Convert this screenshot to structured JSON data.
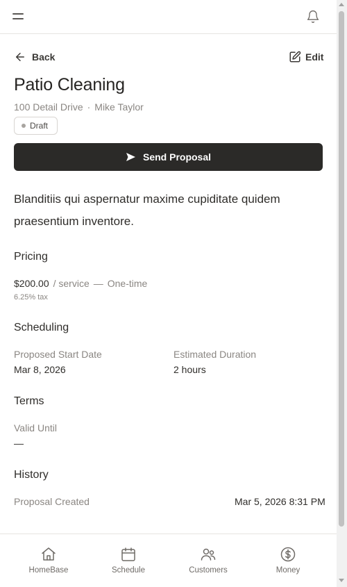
{
  "topbar": {
    "menu_icon": "hamburger-icon",
    "bell_icon": "bell-icon"
  },
  "nav": {
    "back_label": "Back",
    "edit_label": "Edit"
  },
  "job": {
    "title": "Patio Cleaning",
    "address": "100 Detail Drive",
    "separator": "·",
    "customer": "Mike Taylor",
    "status": "Draft",
    "description": "Blanditiis qui aspernatur maxime cupiditate quidem praesentium inventore."
  },
  "actions": {
    "send_label": "Send Proposal"
  },
  "pricing": {
    "heading": "Pricing",
    "amount": "$200.00",
    "unit": "/ service",
    "dash": "—",
    "frequency": "One-time",
    "tax": "6.25% tax"
  },
  "scheduling": {
    "heading": "Scheduling",
    "start_label": "Proposed Start Date",
    "start_value": "Mar 8, 2026",
    "duration_label": "Estimated Duration",
    "duration_value": "2 hours"
  },
  "terms": {
    "heading": "Terms",
    "valid_label": "Valid Until",
    "valid_value": "—"
  },
  "history": {
    "heading": "History",
    "event_label": "Proposal Created",
    "event_time": "Mar 5, 2026 8:31 PM"
  },
  "bottom_nav": [
    {
      "label": "HomeBase",
      "icon": "home-icon"
    },
    {
      "label": "Schedule",
      "icon": "calendar-icon"
    },
    {
      "label": "Customers",
      "icon": "users-icon"
    },
    {
      "label": "Money",
      "icon": "dollar-circle-icon"
    }
  ]
}
